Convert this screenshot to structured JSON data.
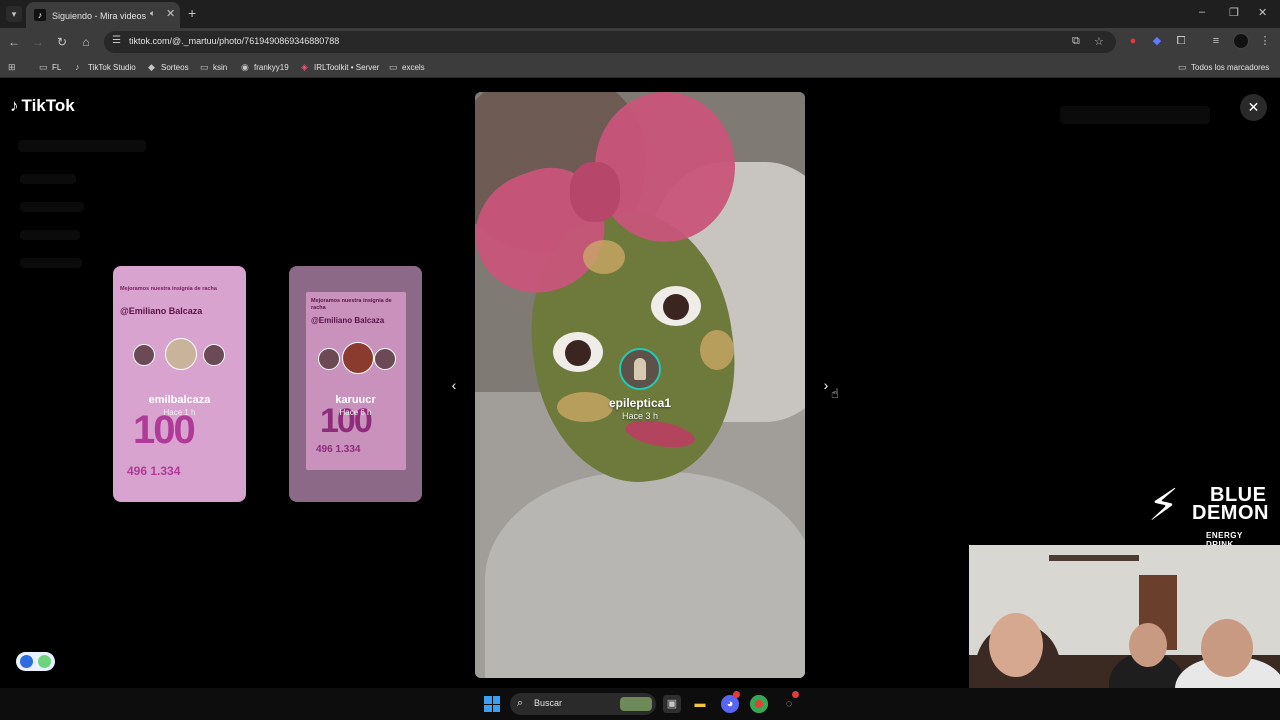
{
  "browser": {
    "tab_title": "Siguiendo - Mira videos pu...",
    "url": "tiktok.com/@._martuu/photo/7619490869346880788",
    "bookmarks": [
      "FL",
      "TikTok Studio",
      "Sorteos",
      "ksin",
      "frankyy19",
      "IRLToolkit • Server",
      "excels"
    ],
    "all_bookmarks": "Todos los marcadores"
  },
  "viewer": {
    "logo": "TikTok",
    "stories": [
      {
        "headline": "Mejoramos nuestra insignia de racha",
        "handle": "@Emiliano Balcaza",
        "big_number": "100",
        "stats": "496  1.334",
        "username": "emilbalcaza",
        "time": "Hace 1 h"
      },
      {
        "headline": "Mejoramos nuestra insignia de racha",
        "handle": "@Emiliano Balcaza",
        "big_number": "100",
        "stats": "496  1.334",
        "username": "karuucr",
        "time": "Hace 6 h"
      }
    ],
    "current": {
      "username": "epileptica1",
      "time": "Hace 3 h"
    }
  },
  "overlay": {
    "brand_line1": "BLUE",
    "brand_line2": "DEMON",
    "brand_line3": "ENERGY DRINK"
  },
  "taskbar": {
    "search_label": "Buscar"
  },
  "colors": {
    "accent_ring": "#25c7b6",
    "story_card": "#d9a3cf",
    "bow": "#c8557a"
  }
}
